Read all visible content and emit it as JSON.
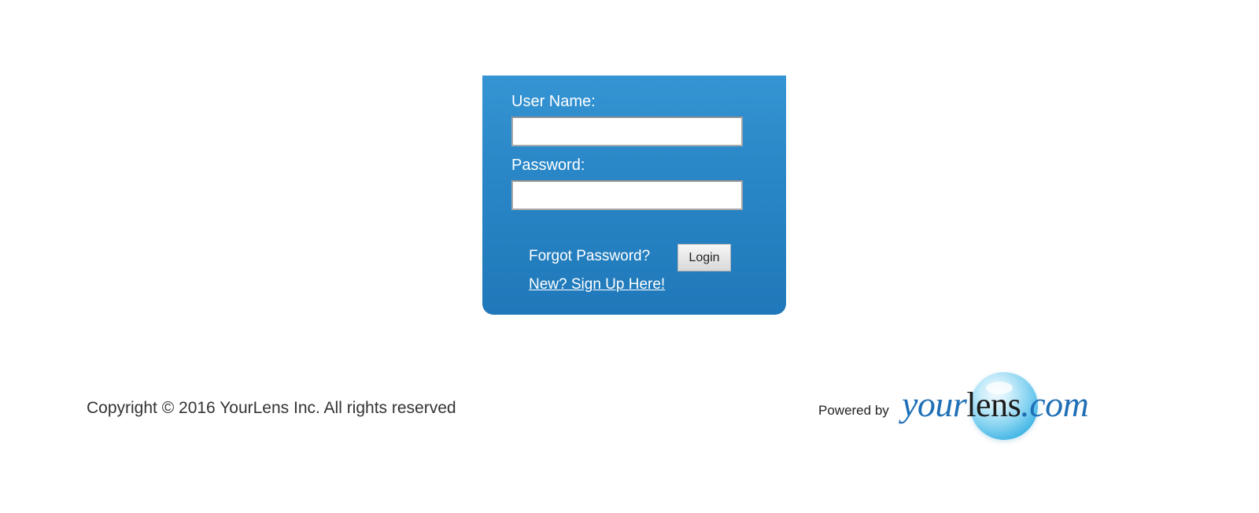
{
  "login": {
    "username_label": "User Name:",
    "username_value": "",
    "password_label": "Password:",
    "password_value": "",
    "forgot_password": "Forgot Password?",
    "login_button": "Login",
    "signup_link": "New? Sign Up Here!"
  },
  "footer": {
    "copyright": "Copyright © 2016 YourLens Inc. All rights reserved",
    "powered_by": "Powered by",
    "logo": {
      "part_a": "your",
      "part_b": "lens",
      "part_c": ".com"
    }
  },
  "colors": {
    "panel_blue": "#2a87c7",
    "logo_blue": "#1f6fb6",
    "bubble_cyan": "#3bb2e3"
  }
}
